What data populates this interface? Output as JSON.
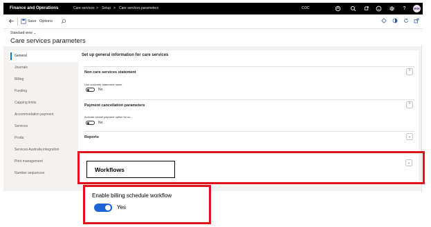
{
  "topbar": {
    "app_name": "Finance and Operations",
    "breadcrumbs": [
      "Care services",
      "Setup",
      "Care services parameters"
    ],
    "separator": ">",
    "company": "COC",
    "icons": [
      "dashboard-icon",
      "search-icon",
      "notifications-icon",
      "smiley-icon",
      "settings-icon",
      "help-icon"
    ],
    "avatar_initials": "WW"
  },
  "actionpane": {
    "save_label": "Save",
    "options_label": "Options",
    "right_icons": [
      "diamond-icon",
      "office-icon",
      "refresh-icon",
      "popout-icon"
    ]
  },
  "header": {
    "view_selector": "Standard view",
    "page_title": "Care services parameters"
  },
  "nav": {
    "items": [
      {
        "label": "General",
        "active": true
      },
      {
        "label": "Journals",
        "active": false
      },
      {
        "label": "Billing",
        "active": false
      },
      {
        "label": "Funding",
        "active": false
      },
      {
        "label": "Capping limits",
        "active": false
      },
      {
        "label": "Accommodation payment",
        "active": false
      },
      {
        "label": "Services",
        "active": false
      },
      {
        "label": "Proda",
        "active": false
      },
      {
        "label": "Services Australia integration",
        "active": false
      },
      {
        "label": "Print management",
        "active": false
      },
      {
        "label": "Number sequences",
        "active": false
      }
    ]
  },
  "content": {
    "heading": "Set up general information for care services",
    "sections": {
      "non_care": {
        "title": "Non care services statement",
        "field_label": "Use customer statement name",
        "value": "No",
        "expanded": true
      },
      "payment": {
        "title": "Payment cancellation parameters",
        "field_label": "Activate cancel payment option for su...",
        "value": "No",
        "expanded": true
      },
      "reports": {
        "title": "Reports",
        "expanded": false
      },
      "workflows": {
        "title": "Workflows",
        "expanded": false
      }
    }
  },
  "callout": {
    "billing_label": "Enable billing schedule workflow",
    "billing_value": "Yes"
  },
  "colors": {
    "topbar": "#000000",
    "accent": "#0078d4",
    "callout_border": "#e0121b",
    "toggle_on": "#1a64d6"
  }
}
